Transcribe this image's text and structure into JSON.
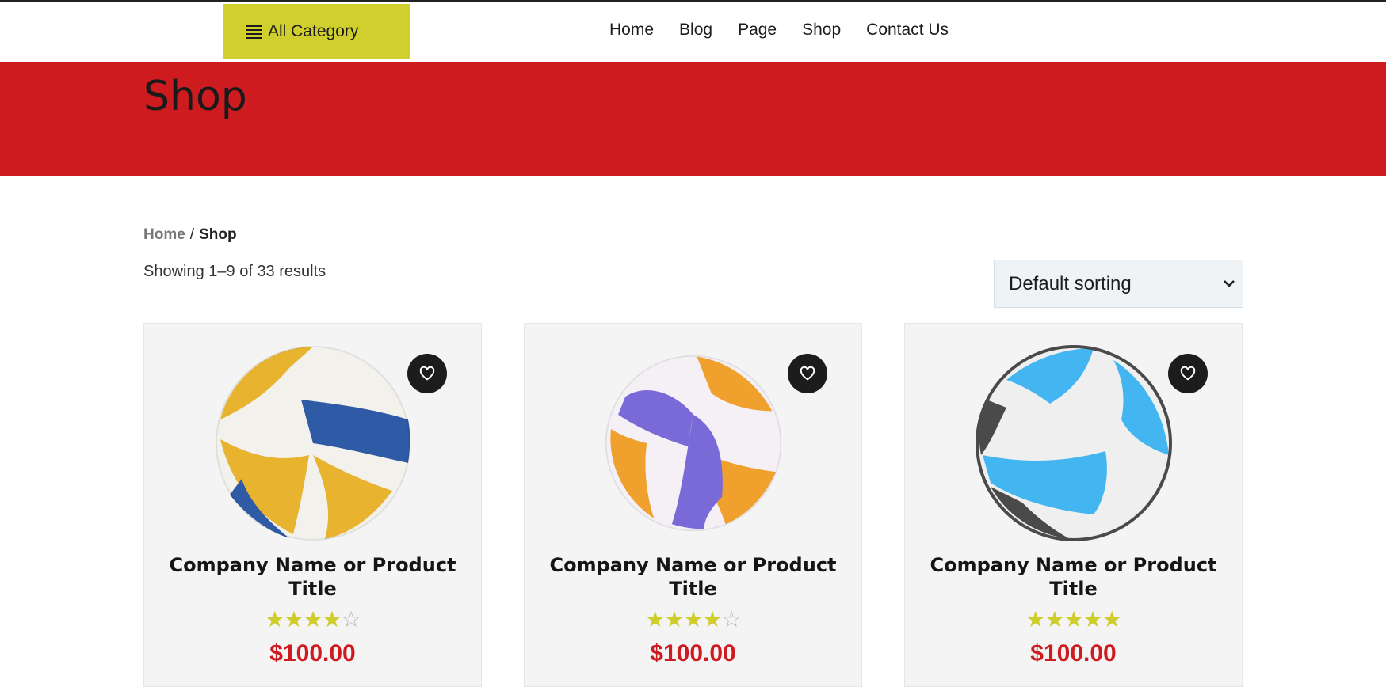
{
  "header": {
    "category_button": "All Category",
    "nav": [
      "Home",
      "Blog",
      "Page",
      "Shop",
      "Contact Us"
    ]
  },
  "banner": {
    "title": "Shop"
  },
  "breadcrumb": {
    "home": "Home",
    "separator": "/",
    "current": "Shop"
  },
  "results_text": "Showing 1–9 of 33 results",
  "sorting": {
    "selected": "Default sorting"
  },
  "products": [
    {
      "title": "Company Name or Product Title",
      "price": "$100.00",
      "rating": 4,
      "max_rating": 5,
      "ball_colors": [
        "#e8b430",
        "#2f5aa6",
        "#f3f1ec"
      ]
    },
    {
      "title": "Company Name or Product Title",
      "price": "$100.00",
      "rating": 4,
      "max_rating": 5,
      "ball_colors": [
        "#f0a02c",
        "#7a6ad8",
        "#f4f0f6"
      ]
    },
    {
      "title": "Company Name or Product Title",
      "price": "$100.00",
      "rating": 5,
      "max_rating": 5,
      "ball_colors": [
        "#43b6f2",
        "#4a4a4a",
        "#efefef"
      ]
    }
  ],
  "colors": {
    "accent": "#d1cf2e",
    "banner": "#cd1b20",
    "price": "#cd1b20",
    "star": "#cfcd2c"
  },
  "icons": {
    "wishlist": "heart-icon",
    "menu": "menu-icon",
    "sort": "chevron-down-icon"
  }
}
